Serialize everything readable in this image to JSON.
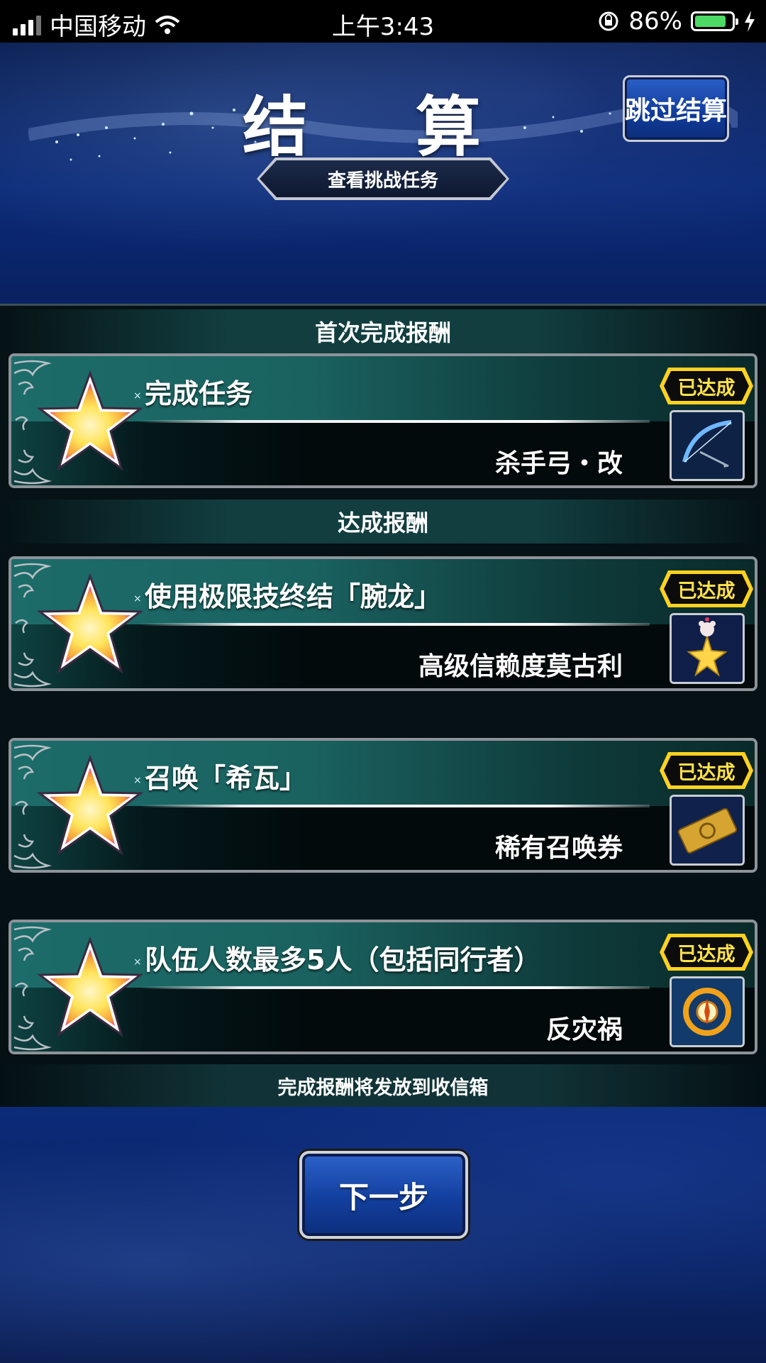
{
  "status_bar": {
    "carrier": "中国移动",
    "time": "上午3:43",
    "battery": "86%",
    "battery_level": 0.86
  },
  "header": {
    "title": "结 算",
    "skip_button": "跳过结算",
    "view_challenges": "查看挑战任务"
  },
  "sections": {
    "first_clear": "首次完成报酬",
    "achievement": "达成报酬"
  },
  "rewards": [
    {
      "title": "完成任务",
      "reward": "杀手弓・改",
      "status": "已达成",
      "icon": "bow-icon"
    },
    {
      "title": "使用极限技终结「腕龙」",
      "reward": "高级信赖度莫古利",
      "status": "已达成",
      "icon": "moogle-star-icon"
    },
    {
      "title": "召唤「希瓦」",
      "reward": "稀有召唤券",
      "status": "已达成",
      "icon": "ticket-icon"
    },
    {
      "title": "队伍人数最多5人（包括同行者）",
      "reward": "反灾祸",
      "status": "已达成",
      "icon": "compass-ring-icon"
    }
  ],
  "footer_note": "完成报酬将发放到收信箱",
  "next_button": "下一步",
  "colors": {
    "accent_teal": "#1c6c6a",
    "badge_gold": "#ffe24a",
    "button_blue": "#123f9e"
  }
}
